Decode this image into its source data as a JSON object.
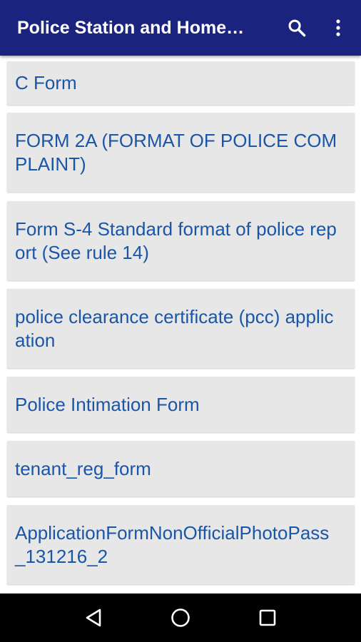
{
  "app_bar": {
    "title": "Police Station and Home…",
    "search_icon": "search-icon",
    "more_icon": "more-vert-icon",
    "background": "#1a237e"
  },
  "forms": [
    {
      "label": "C Form"
    },
    {
      "label": "FORM 2A (FORMAT OF POLICE COMPLAINT)"
    },
    {
      "label": "Form S-4 Standard format of police report (See rule 14)"
    },
    {
      "label": "police clearance certificate (pcc) application"
    },
    {
      "label": "Police Intimation Form"
    },
    {
      "label": "tenant_reg_form"
    },
    {
      "label": "ApplicationFormNonOfficialPhotoPass_131216_2"
    }
  ],
  "nav_bar": {
    "back_icon": "back-triangle-icon",
    "home_icon": "home-circle-icon",
    "recents_icon": "recents-square-icon"
  },
  "colors": {
    "link_text": "#1a56a8",
    "item_background": "#e7e7e7"
  }
}
